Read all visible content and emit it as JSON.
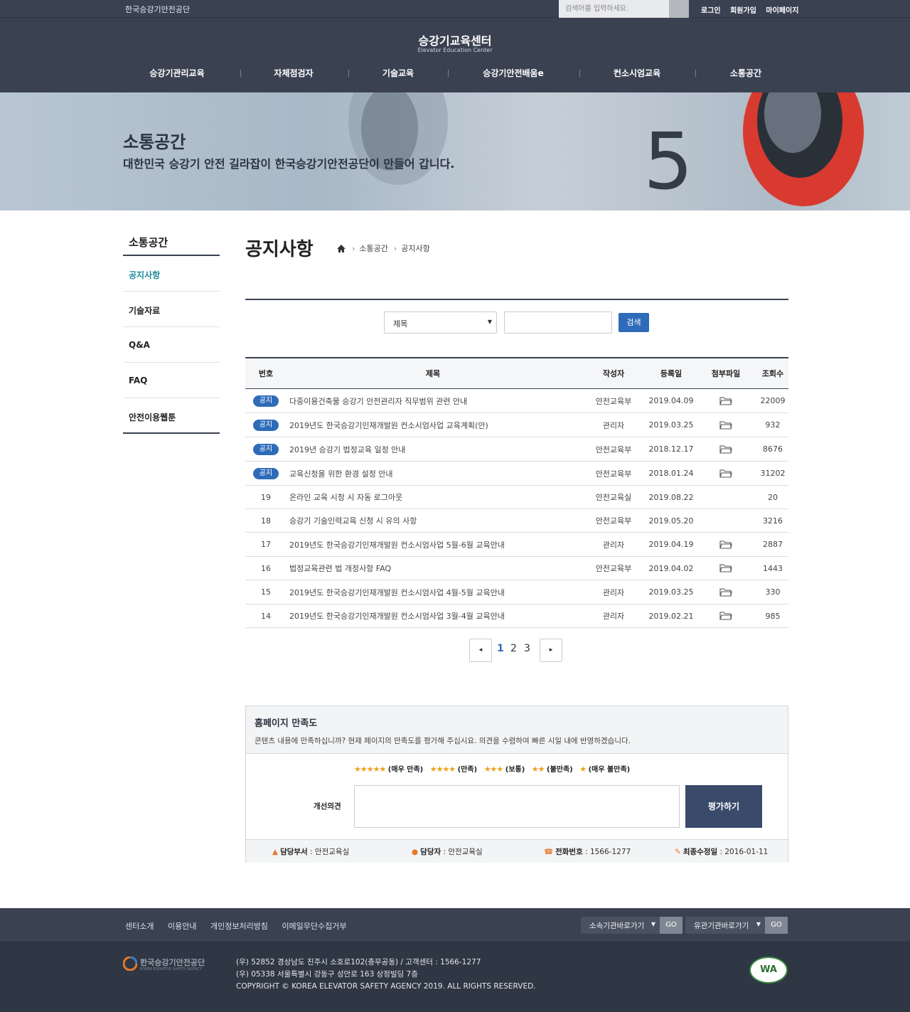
{
  "topbar": {
    "org_name": "한국승강기안전공단",
    "search_placeholder": "검색어를 입력하세요.",
    "links": [
      "로그인",
      "회원가입",
      "마이페이지"
    ]
  },
  "header": {
    "logo_title": "승강기교육센터",
    "logo_sub": "Elevator Education Center",
    "gnb": [
      "승강기관리교육",
      "자체점검자",
      "기술교육",
      "승강기안전배움e",
      "컨소시엄교육",
      "소통공간"
    ]
  },
  "hero": {
    "title": "소통공간",
    "desc": "대한민국 승강기 안전 길라잡이 한국승강기안전공단이 만들어 갑니다."
  },
  "lnb": {
    "title": "소통공간",
    "items": [
      "공지사항",
      "기술자료",
      "Q&A",
      "FAQ",
      "안전이용웹툰"
    ]
  },
  "page": {
    "title": "공지사항",
    "breadcrumb": [
      "소통공간",
      "공지사항"
    ]
  },
  "search": {
    "select_value": "제목",
    "button": "검색"
  },
  "table": {
    "headers": [
      "번호",
      "제목",
      "작성자",
      "등록일",
      "첨부파일",
      "조회수"
    ],
    "rows": [
      {
        "no": "공지",
        "title": "다중이용건축물 승강기 안전관리자 직무범위 관련 안내",
        "author": "안전교육부",
        "date": "2019.04.09",
        "file": true,
        "views": "22009"
      },
      {
        "no": "공지",
        "title": "2019년도 한국승강기인재개발원 컨소시엄사업 교육계획(안)",
        "author": "관리자",
        "date": "2019.03.25",
        "file": true,
        "views": "932"
      },
      {
        "no": "공지",
        "title": "2019년 승강기 법정교육 일정 안내",
        "author": "안전교육부",
        "date": "2018.12.17",
        "file": true,
        "views": "8676"
      },
      {
        "no": "공지",
        "title": "교육신청을 위한 환경 설정 안내",
        "author": "안전교육부",
        "date": "2018.01.24",
        "file": true,
        "views": "31202"
      },
      {
        "no": "19",
        "title": "온라인 교육 시청 시 자동 로그아웃",
        "author": "안전교육실",
        "date": "2019.08.22",
        "file": false,
        "views": "20"
      },
      {
        "no": "18",
        "title": "승강기 기술인력교육 신청 시 유의 사항",
        "author": "안전교육부",
        "date": "2019.05.20",
        "file": false,
        "views": "3216"
      },
      {
        "no": "17",
        "title": "2019년도 한국승강기인재개발원 컨소시엄사업 5월-6월 교육안내",
        "author": "관리자",
        "date": "2019.04.19",
        "file": true,
        "views": "2887"
      },
      {
        "no": "16",
        "title": "법정교육관련 법 개정사항 FAQ",
        "author": "안전교육부",
        "date": "2019.04.02",
        "file": true,
        "views": "1443"
      },
      {
        "no": "15",
        "title": "2019년도 한국승강기인재개발원 컨소시엄사업 4월-5월 교육안내",
        "author": "관리자",
        "date": "2019.03.25",
        "file": true,
        "views": "330"
      },
      {
        "no": "14",
        "title": "2019년도 한국승강기인재개발원 컨소시엄사업 3월-4월 교육안내",
        "author": "관리자",
        "date": "2019.02.21",
        "file": true,
        "views": "985"
      }
    ]
  },
  "pagination": {
    "pages": [
      "1",
      "2",
      "3"
    ],
    "current": "1",
    "prev": "◂",
    "next": "▸"
  },
  "satisfaction": {
    "title": "홈페이지 만족도",
    "desc": "콘텐츠 내용에 만족하십니까? 현재 페이지의 만족도를 평가해 주십시요. 의견을 수렴하여 빠른 시일 내에 반영하겠습니다.",
    "options": [
      {
        "stars": "★★★★★",
        "label": "(매우 만족)"
      },
      {
        "stars": "★★★★",
        "label": "(만족)"
      },
      {
        "stars": "★★★",
        "label": "(보통)"
      },
      {
        "stars": "★★",
        "label": "(불만족)"
      },
      {
        "stars": "★",
        "label": "(매우 불만족)"
      }
    ],
    "opinion_label": "개선의견",
    "submit": "평가하기",
    "info": {
      "dept_label": "담당부서",
      "dept": " : 안전교육실",
      "manager_label": "담당자",
      "manager": " : 안전교육실",
      "phone_label": "전화번호",
      "phone": " : 1566-1277",
      "updated_label": "최종수정일",
      "updated": " : 2016-01-11"
    }
  },
  "footer": {
    "links": [
      "센터소개",
      "이용안내",
      "개인정보처리방침",
      "이메일무단수집거부"
    ],
    "select1": "소속기관바로가기",
    "select2": "유관기관바로가기",
    "go": "GO",
    "logo_name": "한국승강기안전공단",
    "logo_en": "KOREA ELEVATOR SAFETY AGENCY",
    "address1": "(우) 52852 경상남도 진주시 소호로102(충무공동) / 고객센터 : 1566-1277",
    "address2": "(우) 05338 서울특별시 강동구 성안로 163 상정빌딩 7층",
    "copyright": "COPYRIGHT © KOREA ELEVATOR SAFETY AGENCY 2019. ALL RIGHTS RESERVED.",
    "wa_mark": "WA"
  },
  "colors": {
    "header_bg": "#3a4252",
    "accent_blue": "#2e6cb9",
    "active_teal": "#1f8a9a",
    "star": "#f0a01c"
  }
}
